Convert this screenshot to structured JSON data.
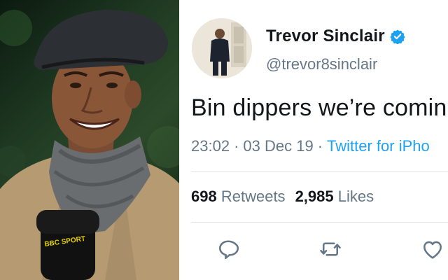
{
  "photo": {
    "mic_label": "BBC SPORT"
  },
  "tweet": {
    "display_name": "Trevor Sinclair",
    "handle": "@trevor8sinclair",
    "text": "Bin dippers we’re comin",
    "time": "23:02",
    "separator": "·",
    "date": "03 Dec 19",
    "source": "Twitter for iPho",
    "retweets_count": "698",
    "retweets_label": "Retweets",
    "likes_count": "2,985",
    "likes_label": "Likes"
  },
  "colors": {
    "verified": "#1da1f2",
    "link": "#1da1f2",
    "secondary_text": "#657786",
    "icon": "#657786"
  },
  "icons": {
    "reply": "reply-icon",
    "retweet": "retweet-icon",
    "like": "like-icon",
    "verified": "verified-badge-icon"
  }
}
